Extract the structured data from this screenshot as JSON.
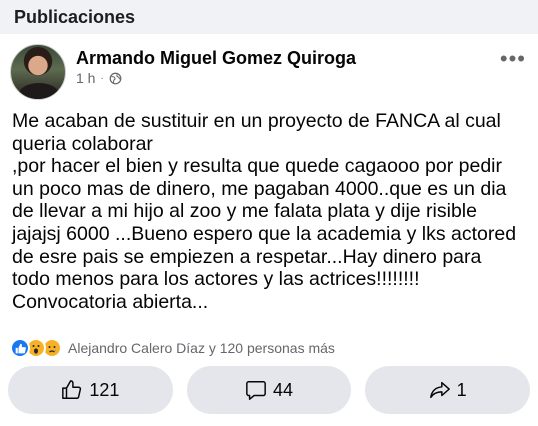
{
  "section": {
    "title": "Publicaciones"
  },
  "post": {
    "author": "Armando Miguel Gomez Quiroga",
    "time": "1 h",
    "separator": "·",
    "more_label": "•••",
    "lines": [
      "Me acaban de sustituir en un proyecto de FANCA al cual",
      "queria colaborar",
      ",por hacer el bien y resulta que quede cagaooo por pedir",
      "un poco mas de dinero, me pagaban 4000..que es un dia",
      "de llevar a mi hijo al zoo y me falata plata y dije risible",
      "jajajsj 6000 ...Bueno espero que la academia y lks actored",
      "de esre pais se empiezen a respetar...Hay dinero para",
      "todo menos para los actores y las actrices!!!!!!!!",
      "Convocatoria  abierta..."
    ]
  },
  "reactions": {
    "icons": [
      "like-icon",
      "wow-icon",
      "sad-icon"
    ],
    "summary": "Alejandro Calero Díaz y 120 personas más"
  },
  "actions": {
    "like_count": "121",
    "comment_count": "44",
    "share_count": "1"
  },
  "colors": {
    "background": "#f0f2f5",
    "card": "#ffffff",
    "button": "#e4e6eb",
    "secondary_text": "#65676b",
    "like_blue": "#1877f2",
    "reaction_yellow": "#f7b125"
  }
}
